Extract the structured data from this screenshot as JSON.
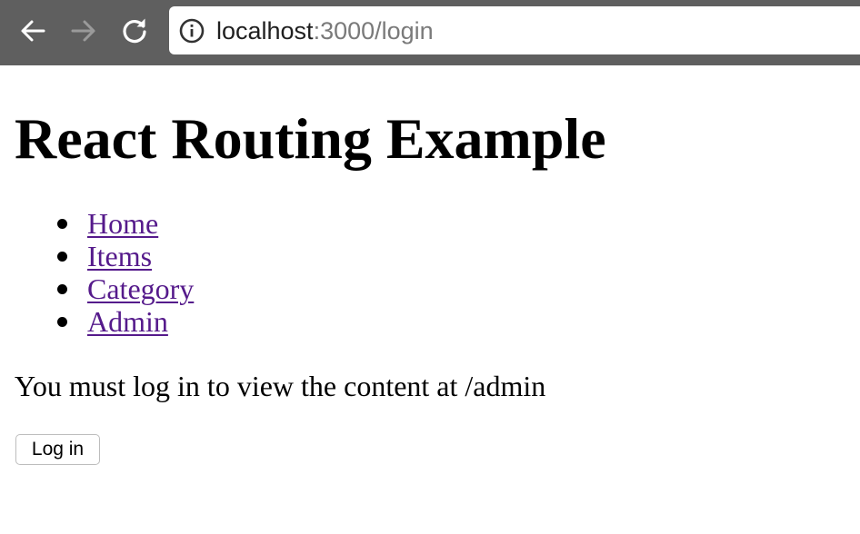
{
  "browser": {
    "url_host": "localhost",
    "url_rest": ":3000/login",
    "icons": {
      "back": "arrow-left-icon",
      "forward": "arrow-right-icon",
      "reload": "reload-icon",
      "info": "info-icon"
    },
    "colors": {
      "toolbar": "#5f5f5f",
      "omnibox": "#ffffff"
    }
  },
  "page": {
    "title": "React Routing Example",
    "nav": [
      {
        "label": "Home"
      },
      {
        "label": "Items"
      },
      {
        "label": "Category"
      },
      {
        "label": "Admin"
      }
    ],
    "message": "You must log in to view the content at /admin",
    "login_button": "Log in",
    "colors": {
      "link_visited": "#551a8b",
      "text": "#000000"
    }
  }
}
